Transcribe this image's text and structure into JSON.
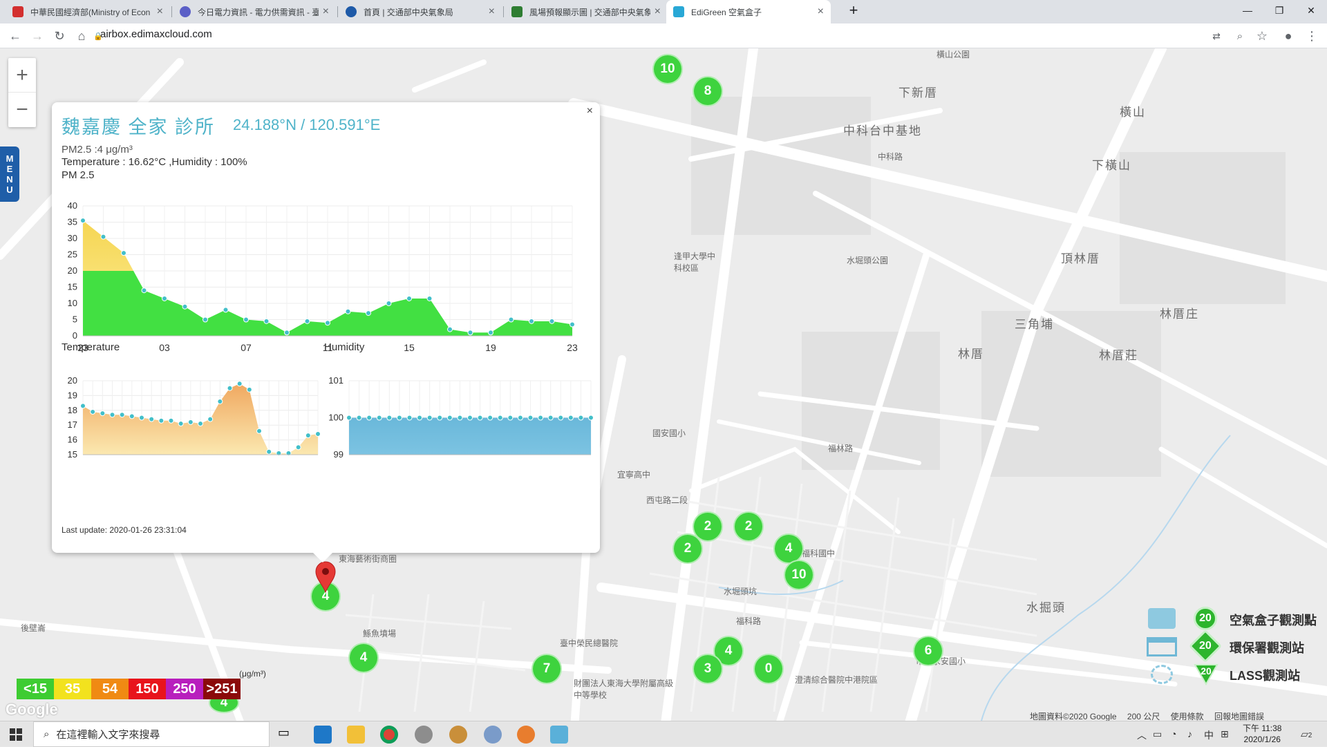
{
  "browser": {
    "tabs": [
      {
        "title": "中華民國經濟部(Ministry of Econ",
        "color": "#d32f2f"
      },
      {
        "title": "今日電力資訊 - 電力供需資訊 - 臺",
        "color": "#5b5fc7"
      },
      {
        "title": "首頁 | 交通部中央氣象局",
        "color": "#1e5aa8"
      },
      {
        "title": "風場預報顯示圖 | 交通部中央氣象",
        "color": "#2e7d32"
      },
      {
        "title": "EdiGreen 空氣盒子",
        "color": "#29a8d6"
      }
    ],
    "new_tab": "+",
    "url": "airbox.edimaxcloud.com"
  },
  "map": {
    "zoom_in": "+",
    "zoom_out": "−",
    "menu_letters": [
      "M",
      "E",
      "N",
      "U"
    ],
    "labels": [
      {
        "text": "下新厝"
      },
      {
        "text": "中科台中基地"
      },
      {
        "text": "橫山"
      },
      {
        "text": "下橫山"
      },
      {
        "text": "頂林厝"
      },
      {
        "text": "水堀頭公園"
      },
      {
        "text": "逢甲大學中科校區"
      },
      {
        "text": "三角埔"
      },
      {
        "text": "林厝庄"
      },
      {
        "text": "林厝"
      },
      {
        "text": "林厝莊"
      },
      {
        "text": "國安國小"
      },
      {
        "text": "宜寧高中"
      },
      {
        "text": "西屯路二段"
      },
      {
        "text": "東海藝術街商圈"
      },
      {
        "text": "水堀頭坑"
      },
      {
        "text": "福科國中"
      },
      {
        "text": "福林路"
      },
      {
        "text": "後壁崙"
      },
      {
        "text": "鯀魚墳場"
      },
      {
        "text": "臺中榮民總醫院"
      },
      {
        "text": "財團法人東海大學附屬高級中等學校"
      },
      {
        "text": "澄清綜合醫院中港院區"
      },
      {
        "text": "市立永安國小"
      },
      {
        "text": "水掘頭"
      },
      {
        "text": "橫山公園"
      },
      {
        "text": "中科路"
      },
      {
        "text": "福科路"
      }
    ],
    "clusters": [
      {
        "value": "10"
      },
      {
        "value": "8"
      },
      {
        "value": "2"
      },
      {
        "value": "2"
      },
      {
        "value": "2"
      },
      {
        "value": "4"
      },
      {
        "value": "10"
      },
      {
        "value": "4"
      },
      {
        "value": "4"
      },
      {
        "value": "7"
      },
      {
        "value": "3"
      },
      {
        "value": "0"
      },
      {
        "value": "6"
      },
      {
        "value": "4"
      },
      {
        "value": "4"
      }
    ],
    "scale": [
      {
        "label": "<15",
        "color": "#3ecc32"
      },
      {
        "label": "35",
        "color": "#f2e21e"
      },
      {
        "label": "54",
        "color": "#f08a13"
      },
      {
        "label": "150",
        "color": "#e8141c"
      },
      {
        "label": "250",
        "color": "#b81fbd"
      },
      {
        "label": ">251",
        "color": "#8b0a0a"
      }
    ],
    "scale_unit": "(μg/m³)",
    "legend": [
      {
        "label": "空氣盒子觀測點",
        "value": "20"
      },
      {
        "label": "環保署觀測站",
        "value": "20"
      },
      {
        "label": "LASS觀測站",
        "value": "20"
      }
    ],
    "attribution": [
      "地圖資料©2020 Google",
      "200 公尺",
      "使用條款",
      "回報地圖錯誤"
    ],
    "google_logo": "Google"
  },
  "popup": {
    "close": "×",
    "title": "魏嘉慶 全家 診所",
    "coordinates": "24.188°N / 120.591°E",
    "pm_line": "PM2.5 :4 μg/m³",
    "temp_hum_line": "Temperature : 16.62°C ,Humidity : 100%",
    "pm_label": "PM 2.5",
    "temp_label": "Temperature",
    "hum_label": "Humidity",
    "last_update": "Last update: 2020-01-26 23:31:04"
  },
  "chart_data": [
    {
      "type": "area",
      "title": "PM 2.5",
      "ylim": [
        0,
        40
      ],
      "yticks": [
        0,
        5,
        10,
        15,
        20,
        25,
        30,
        35,
        40
      ],
      "xticks": [
        "23",
        "03",
        "07",
        "11",
        "15",
        "19",
        "23"
      ],
      "values": [
        35.5,
        30.5,
        25.5,
        14,
        11.5,
        9,
        5,
        8,
        5,
        4.5,
        1,
        4.5,
        4,
        7.5,
        7,
        10,
        11.5,
        11.5,
        2,
        1,
        1,
        5,
        4.5,
        4.5,
        3.5
      ],
      "grid": true
    },
    {
      "type": "area",
      "title": "Temperature",
      "ylim": [
        15,
        20
      ],
      "yticks": [
        15,
        16,
        17,
        18,
        19,
        20
      ],
      "values": [
        18.3,
        17.9,
        17.8,
        17.7,
        17.7,
        17.6,
        17.5,
        17.4,
        17.3,
        17.3,
        17.1,
        17.2,
        17.1,
        17.4,
        18.6,
        19.5,
        19.8,
        19.4,
        16.6,
        15.2,
        15.1,
        15.1,
        15.5,
        16.3,
        16.4
      ],
      "grid": true
    },
    {
      "type": "area",
      "title": "Humidity",
      "ylim": [
        99,
        101
      ],
      "yticks": [
        99,
        100,
        101
      ],
      "values": [
        100,
        100,
        100,
        100,
        100,
        100,
        100,
        100,
        100,
        100,
        100,
        100,
        100,
        100,
        100,
        100,
        100,
        100,
        100,
        100,
        100,
        100,
        100,
        100,
        100
      ],
      "grid": true
    }
  ],
  "taskbar": {
    "search_placeholder": "在這裡輸入文字來搜尋",
    "time": "下午 11:38",
    "date": "2020/1/26",
    "ime": "中",
    "notifications": "2"
  }
}
